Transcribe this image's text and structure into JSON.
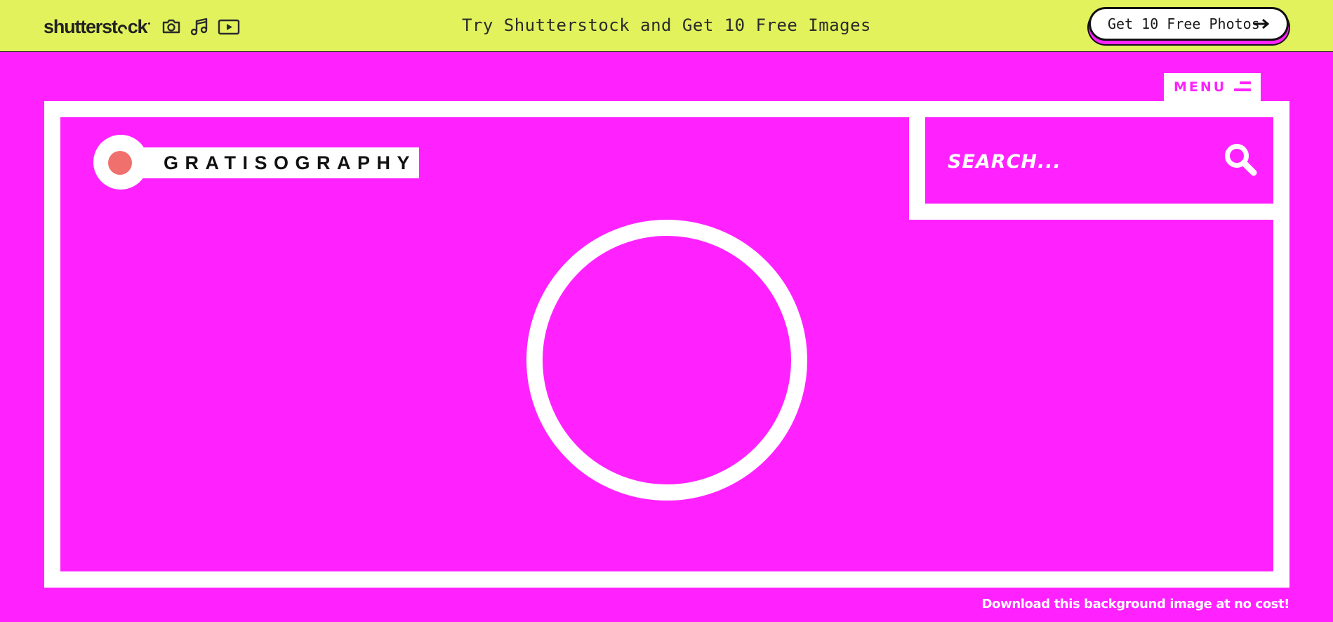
{
  "topbar": {
    "logo_text_pre": "shutterst",
    "logo_text_post": "ck",
    "media_icons": [
      "camera-icon",
      "music-note-icon",
      "video-play-icon"
    ],
    "promo": "Try Shutterstock and Get 10 Free Images",
    "cta_label": "Get 10 Free Photos",
    "background_color": "#e1f25c"
  },
  "menu": {
    "label": "MENU"
  },
  "brand": {
    "name": "GRATISOGRAPHY",
    "dot_color": "#f0706e"
  },
  "search": {
    "placeholder": "SEARCH..."
  },
  "footer": {
    "download_link": "Download this background image at no cost!"
  },
  "theme": {
    "page_background": "#ff22ff",
    "frame_color": "#ffffff"
  }
}
